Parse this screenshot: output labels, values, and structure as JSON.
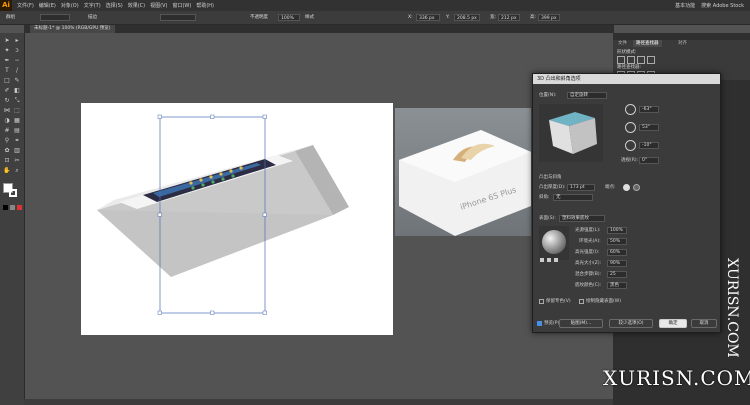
{
  "app": {
    "logo": "Ai",
    "menus": [
      "文件(F)",
      "编辑(E)",
      "对象(O)",
      "文字(T)",
      "选择(S)",
      "效果(C)",
      "视图(V)",
      "窗口(W)",
      "帮助(H)"
    ],
    "workspace": "基本功能",
    "search_placeholder": "搜索 Adobe Stock"
  },
  "control_bar": {
    "selection": "群组",
    "stroke_label": "描边",
    "opacity_label": "不透明度",
    "opacity_value": "100%",
    "style_label": "样式",
    "x_label": "X:",
    "x_value": "336 px",
    "y_label": "Y:",
    "y_value": "208.5 px",
    "w_label": "宽:",
    "w_value": "212 px",
    "h_label": "高:",
    "h_value": "399 px"
  },
  "document": {
    "tab_title": "未标题-1* @ 100% (RGB/GPU 预览)"
  },
  "right_panel": {
    "tabs": [
      "文件",
      "路径查找器",
      "对齐"
    ],
    "shape_modes_label": "形状模式:",
    "pathfinder_label": "路径查找器:"
  },
  "dialog_3d": {
    "title": "3D 凸出和斜角选项",
    "position_label": "位置(N):",
    "position_value": "自定旋转",
    "rot_x": "-63°",
    "rot_y": "53°",
    "rot_z": "-10°",
    "perspective_label": "透视(R):",
    "perspective_value": "0°",
    "extrude_section": "凸出与斜角",
    "extrude_depth_label": "凸出厚度(D):",
    "extrude_depth_value": "173 pt",
    "cap_label": "端点:",
    "bevel_label": "斜角:",
    "bevel_value": "无",
    "surface_label": "表面(S):",
    "surface_value": "塑料效果底纹",
    "light_intensity_label": "光源强度(L):",
    "light_intensity_value": "100%",
    "ambient_label": "环境光(A):",
    "ambient_value": "50%",
    "highlight_intensity_label": "高光强度(I):",
    "highlight_intensity_value": "60%",
    "highlight_size_label": "高光大小(Z):",
    "highlight_size_value": "90%",
    "blend_steps_label": "混合步骤(B):",
    "blend_steps_value": "25",
    "shading_color_label": "底纹颜色(C):",
    "shading_color_value": "黑色",
    "preserve_spot_label": "保留专色(V)",
    "draw_hidden_label": "绘制隐藏表面(W)",
    "preview_label": "预览(P)",
    "map_button": "贴图(M)...",
    "fewer_options_button": "较少选项(O)",
    "ok_button": "确定",
    "cancel_button": "取消"
  },
  "photo_label": "iPhone 6S Plus",
  "watermark": {
    "vertical": "XURISN.COM",
    "bottom": "XURISN.COM"
  },
  "colors": {
    "accent": "#ff9a00",
    "selection": "#4a6fb5",
    "box_top": "#6fb3c4"
  }
}
